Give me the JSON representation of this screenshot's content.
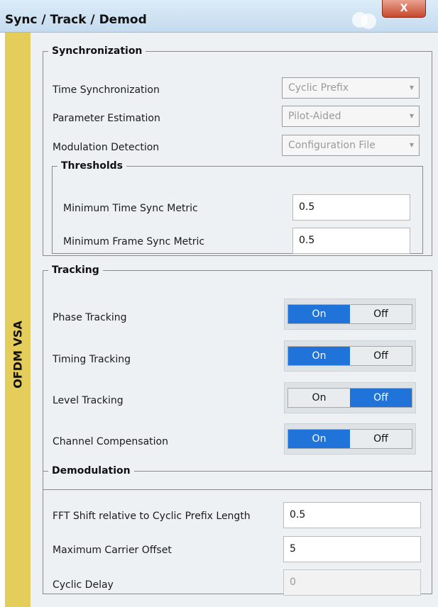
{
  "window": {
    "title": "Sync / Track / Demod",
    "close_label": "X",
    "side_tab_label": "OFDM VSA"
  },
  "synchronization": {
    "legend": "Synchronization",
    "time_sync_label": "Time Synchronization",
    "time_sync_value": "Cyclic Prefix",
    "param_est_label": "Parameter Estimation",
    "param_est_value": "Pilot-Aided",
    "mod_detect_label": "Modulation Detection",
    "mod_detect_value": "Configuration File",
    "thresholds": {
      "legend": "Thresholds",
      "min_time_sync_label": "Minimum Time Sync Metric",
      "min_time_sync_value": "0.5",
      "min_frame_sync_label": "Minimum Frame Sync Metric",
      "min_frame_sync_value": "0.5"
    }
  },
  "tracking": {
    "legend": "Tracking",
    "on_label": "On",
    "off_label": "Off",
    "phase_label": "Phase Tracking",
    "phase_state": "On",
    "timing_label": "Timing Tracking",
    "timing_state": "On",
    "level_label": "Level Tracking",
    "level_state": "Off",
    "channel_label": "Channel Compensation",
    "channel_state": "On"
  },
  "demodulation": {
    "legend": "Demodulation",
    "fft_shift_label": "FFT Shift relative to Cyclic Prefix Length",
    "fft_shift_value": "0.5",
    "max_carrier_label": "Maximum Carrier Offset",
    "max_carrier_value": "5",
    "cyclic_delay_label": "Cyclic Delay",
    "cyclic_delay_value": "0"
  },
  "colors": {
    "title_bar": "#c4dbef",
    "side_tab": "#e5cd5c",
    "toggle_active": "#1f73d9",
    "panel_background": "#eef1f4"
  }
}
